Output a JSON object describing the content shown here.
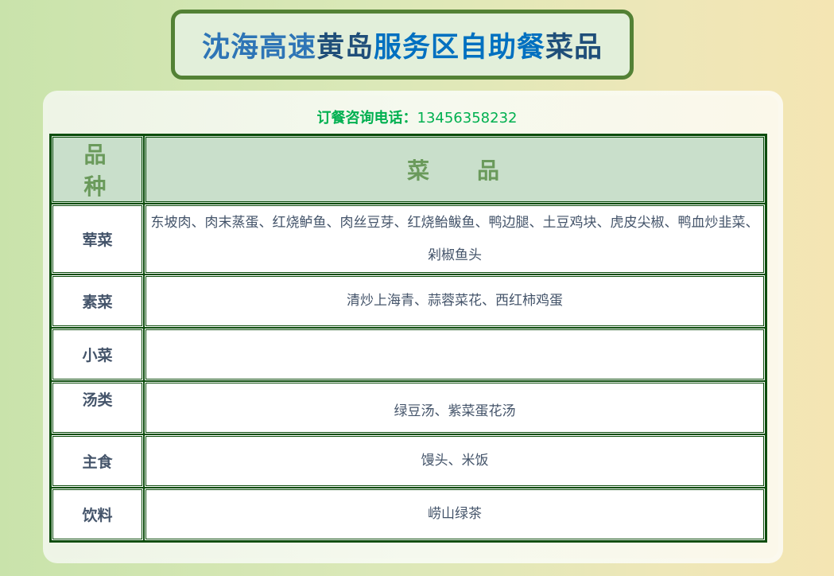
{
  "title": {
    "part1": "沈海高速",
    "part2": "黄岛",
    "part3": "服务区自助餐",
    "part4": "菜品"
  },
  "contact": {
    "label1": "订餐咨询",
    "label2": "电话：",
    "phone": "13456358232"
  },
  "table": {
    "headers": {
      "category": "品种",
      "dishes": "菜品"
    },
    "rows": [
      {
        "category": "荤菜",
        "dishes": "东坡肉、肉末蒸蛋、红烧鲈鱼、肉丝豆芽、红烧鲐鲅鱼、鸭边腿、土豆鸡块、虎皮尖椒、鸭血炒韭菜、剁椒鱼头"
      },
      {
        "category": "素菜",
        "dishes": "清炒上海青、蒜蓉菜花、西红柿鸡蛋"
      },
      {
        "category": "小菜",
        "dishes": ""
      },
      {
        "category": "汤类",
        "dishes": "绿豆汤、紫菜蛋花汤"
      },
      {
        "category": "主食",
        "dishes": "馒头、米饭"
      },
      {
        "category": "饮料",
        "dishes": "崂山绿茶"
      }
    ]
  },
  "colors": {
    "title_border": "#538135",
    "title_bg": "#e2efda",
    "table_border": "#0d4d0d",
    "header_bg": "#c9dfcb",
    "header_text": "#6a9a5b",
    "body_text": "#44546a",
    "contact_text": "#00b050"
  }
}
